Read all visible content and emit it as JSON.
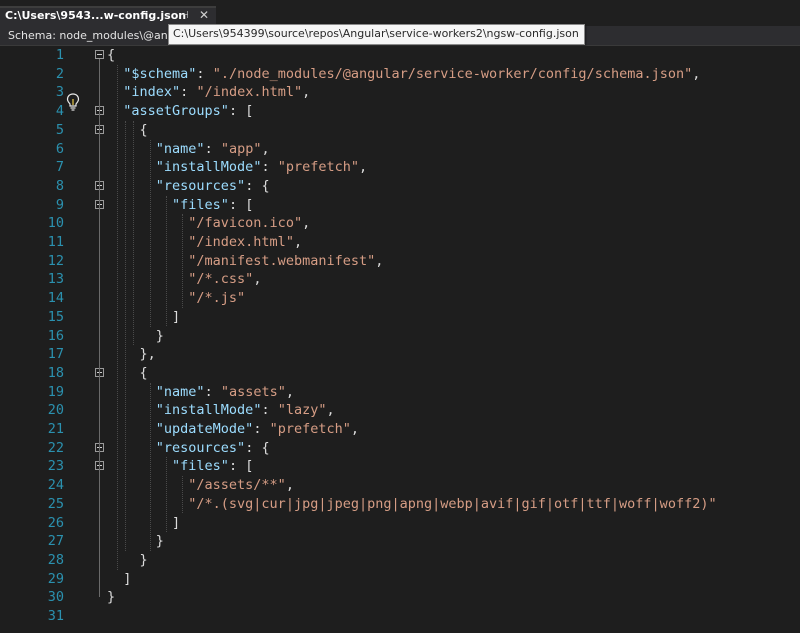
{
  "tab": {
    "title": "C:\\Users\\9543...w-config.json"
  },
  "schema_bar": {
    "text": "Schema:  node_modules\\@angular"
  },
  "tooltip": {
    "text": "C:\\Users\\954399\\source\\repos\\Angular\\service-workers2\\ngsw-config.json"
  },
  "colors": {
    "line_number": "#2b91af",
    "property": "#9cdcfe",
    "string": "#d69d85",
    "punctuation": "#dcdcdc",
    "background": "#1e1e1e"
  },
  "editor": {
    "lines": [
      {
        "n": "1",
        "code": [
          [
            "p",
            "{"
          ]
        ]
      },
      {
        "n": "2",
        "code": [
          [
            "p",
            "  "
          ],
          [
            "k",
            "\"$schema\""
          ],
          [
            "p",
            ": "
          ],
          [
            "s",
            "\"./node_modules/@angular/service-worker/config/schema.json\""
          ],
          [
            "p",
            ","
          ]
        ]
      },
      {
        "n": "3",
        "code": [
          [
            "p",
            "  "
          ],
          [
            "k",
            "\"index\""
          ],
          [
            "p",
            ": "
          ],
          [
            "s",
            "\"/index.html\""
          ],
          [
            "p",
            ","
          ]
        ]
      },
      {
        "n": "4",
        "code": [
          [
            "p",
            "  "
          ],
          [
            "k",
            "\"assetGroups\""
          ],
          [
            "p",
            ": ["
          ]
        ]
      },
      {
        "n": "5",
        "code": [
          [
            "p",
            "    {"
          ]
        ]
      },
      {
        "n": "6",
        "code": [
          [
            "p",
            "      "
          ],
          [
            "k",
            "\"name\""
          ],
          [
            "p",
            ": "
          ],
          [
            "s",
            "\"app\""
          ],
          [
            "p",
            ","
          ]
        ]
      },
      {
        "n": "7",
        "code": [
          [
            "p",
            "      "
          ],
          [
            "k",
            "\"installMode\""
          ],
          [
            "p",
            ": "
          ],
          [
            "s",
            "\"prefetch\""
          ],
          [
            "p",
            ","
          ]
        ]
      },
      {
        "n": "8",
        "code": [
          [
            "p",
            "      "
          ],
          [
            "k",
            "\"resources\""
          ],
          [
            "p",
            ": {"
          ]
        ]
      },
      {
        "n": "9",
        "code": [
          [
            "p",
            "        "
          ],
          [
            "k",
            "\"files\""
          ],
          [
            "p",
            ": ["
          ]
        ]
      },
      {
        "n": "10",
        "code": [
          [
            "p",
            "          "
          ],
          [
            "s",
            "\"/favicon.ico\""
          ],
          [
            "p",
            ","
          ]
        ]
      },
      {
        "n": "11",
        "code": [
          [
            "p",
            "          "
          ],
          [
            "s",
            "\"/index.html\""
          ],
          [
            "p",
            ","
          ]
        ]
      },
      {
        "n": "12",
        "code": [
          [
            "p",
            "          "
          ],
          [
            "s",
            "\"/manifest.webmanifest\""
          ],
          [
            "p",
            ","
          ]
        ]
      },
      {
        "n": "13",
        "code": [
          [
            "p",
            "          "
          ],
          [
            "s",
            "\"/*.css\""
          ],
          [
            "p",
            ","
          ]
        ]
      },
      {
        "n": "14",
        "code": [
          [
            "p",
            "          "
          ],
          [
            "s",
            "\"/*.js\""
          ]
        ]
      },
      {
        "n": "15",
        "code": [
          [
            "p",
            "        ]"
          ]
        ]
      },
      {
        "n": "16",
        "code": [
          [
            "p",
            "      }"
          ]
        ]
      },
      {
        "n": "17",
        "code": [
          [
            "p",
            "    },"
          ]
        ]
      },
      {
        "n": "18",
        "code": [
          [
            "p",
            "    {"
          ]
        ]
      },
      {
        "n": "19",
        "code": [
          [
            "p",
            "      "
          ],
          [
            "k",
            "\"name\""
          ],
          [
            "p",
            ": "
          ],
          [
            "s",
            "\"assets\""
          ],
          [
            "p",
            ","
          ]
        ]
      },
      {
        "n": "20",
        "code": [
          [
            "p",
            "      "
          ],
          [
            "k",
            "\"installMode\""
          ],
          [
            "p",
            ": "
          ],
          [
            "s",
            "\"lazy\""
          ],
          [
            "p",
            ","
          ]
        ]
      },
      {
        "n": "21",
        "code": [
          [
            "p",
            "      "
          ],
          [
            "k",
            "\"updateMode\""
          ],
          [
            "p",
            ": "
          ],
          [
            "s",
            "\"prefetch\""
          ],
          [
            "p",
            ","
          ]
        ]
      },
      {
        "n": "22",
        "code": [
          [
            "p",
            "      "
          ],
          [
            "k",
            "\"resources\""
          ],
          [
            "p",
            ": {"
          ]
        ]
      },
      {
        "n": "23",
        "code": [
          [
            "p",
            "        "
          ],
          [
            "k",
            "\"files\""
          ],
          [
            "p",
            ": ["
          ]
        ]
      },
      {
        "n": "24",
        "code": [
          [
            "p",
            "          "
          ],
          [
            "s",
            "\"/assets/**\""
          ],
          [
            "p",
            ","
          ]
        ]
      },
      {
        "n": "25",
        "code": [
          [
            "p",
            "          "
          ],
          [
            "s",
            "\"/*.(svg|cur|jpg|jpeg|png|apng|webp|avif|gif|otf|ttf|woff|woff2)\""
          ]
        ]
      },
      {
        "n": "26",
        "code": [
          [
            "p",
            "        ]"
          ]
        ]
      },
      {
        "n": "27",
        "code": [
          [
            "p",
            "      }"
          ]
        ]
      },
      {
        "n": "28",
        "code": [
          [
            "p",
            "    }"
          ]
        ]
      },
      {
        "n": "29",
        "code": [
          [
            "p",
            "  ]"
          ]
        ]
      },
      {
        "n": "30",
        "code": [
          [
            "p",
            "}"
          ]
        ]
      },
      {
        "n": "31",
        "code": []
      }
    ],
    "foldable_lines": [
      "1",
      "4",
      "5",
      "8",
      "9",
      "18",
      "22",
      "23"
    ],
    "lightbulb_line": "1"
  }
}
